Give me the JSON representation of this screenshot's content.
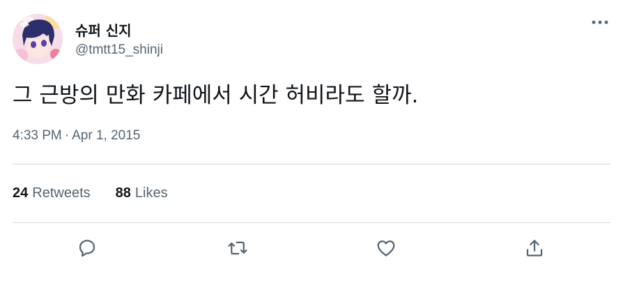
{
  "author": {
    "display_name": "슈퍼 신지",
    "handle": "@tmtt15_shinji",
    "avatar_icon": "anime-character-avatar"
  },
  "tweet": {
    "text": "그 근방의 만화 카페에서 시간 허비라도 할까.",
    "time": "4:33 PM",
    "separator": "·",
    "date": "Apr 1, 2015"
  },
  "stats": {
    "retweets_count": "24",
    "retweets_label": "Retweets",
    "likes_count": "88",
    "likes_label": "Likes"
  },
  "actions": {
    "reply_icon": "reply-icon",
    "retweet_icon": "retweet-icon",
    "like_icon": "heart-icon",
    "share_icon": "share-icon"
  },
  "colors": {
    "primary_text": "#0f1419",
    "secondary_text": "#536471",
    "divider": "#cfd9de",
    "background": "#ffffff"
  }
}
